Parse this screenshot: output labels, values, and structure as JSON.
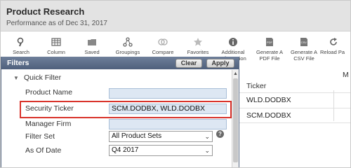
{
  "header": {
    "title": "Product Research",
    "subtitle": "Performance as of Dec 31, 2017"
  },
  "toolbar": {
    "items": [
      {
        "label": "Search",
        "icon": "search-icon"
      },
      {
        "label": "Column",
        "icon": "column-icon"
      },
      {
        "label": "Saved",
        "icon": "folder-icon"
      },
      {
        "label": "Groupings",
        "icon": "groupings-icon"
      },
      {
        "label": "Compare",
        "icon": "compare-icon"
      },
      {
        "label": "Favorites",
        "icon": "star-icon"
      },
      {
        "label": "Additional",
        "label2": "Information",
        "icon": "info-icon"
      },
      {
        "label": "Generate A",
        "label2": "PDF File",
        "icon": "pdf-icon"
      },
      {
        "label": "Generate A",
        "label2": "CSV File",
        "icon": "csv-icon"
      },
      {
        "label": "Reload Pa",
        "icon": "reload-icon"
      }
    ]
  },
  "filters": {
    "title": "Filters",
    "clear_label": "Clear",
    "apply_label": "Apply",
    "quick_filter_label": "Quick Filter",
    "fields": {
      "product_name": {
        "label": "Product Name",
        "value": ""
      },
      "security_ticker": {
        "label": "Security Ticker",
        "value": "SCM.DODBX, WLD.DODBX"
      },
      "manager_firm": {
        "label": "Manager Firm",
        "value": ""
      },
      "filter_set": {
        "label": "Filter Set",
        "value": "All Product Sets"
      },
      "as_of_date": {
        "label": "As Of Date",
        "value": "Q4 2017"
      }
    }
  },
  "results": {
    "columns": {
      "ticker": "Ticker",
      "m": "M"
    },
    "rows": [
      "WLD.DODBX",
      "SCM.DODBX"
    ]
  },
  "colors": {
    "header_bg": "#e3e3e3",
    "filters_bar": "#5a6b85",
    "input_bg": "#dde7f3",
    "highlight": "#d9332b"
  }
}
